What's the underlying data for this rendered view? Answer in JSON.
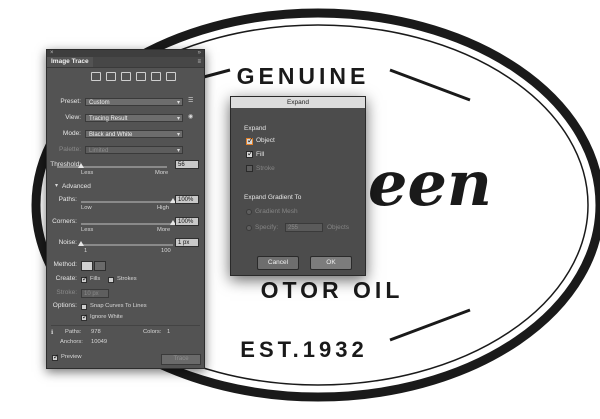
{
  "logo": {
    "top_text": "GENUINE",
    "middle_text": "een",
    "bottom_text": "OTOR OIL",
    "bottom_line": "EST.1932"
  },
  "panel": {
    "close_glyph": "×",
    "collapse_glyph": "»",
    "title": "Image Trace",
    "menu_glyph": "≡",
    "icons": [
      "auto-color-icon",
      "high-color-icon",
      "low-color-icon",
      "grayscale-icon",
      "black-white-icon",
      "outline-icon"
    ],
    "preset_label": "Preset:",
    "preset_value": "Custom",
    "view_label": "View:",
    "view_value": "Tracing Result",
    "mode_label": "Mode:",
    "mode_value": "Black and White",
    "palette_label": "Palette:",
    "palette_value": "Limited",
    "threshold_label": "Threshold:",
    "threshold_value": "56",
    "threshold_min": "Less",
    "threshold_max": "More",
    "advanced_label": "Advanced",
    "paths_label": "Paths:",
    "paths_value": "100%",
    "paths_min": "Low",
    "paths_max": "High",
    "corners_label": "Corners:",
    "corners_value": "100%",
    "corners_min": "Less",
    "corners_max": "More",
    "noise_label": "Noise:",
    "noise_value": "1 px",
    "noise_min": "1",
    "noise_max": "100",
    "method_label": "Method:",
    "create_label": "Create:",
    "fills_label": "Fills",
    "strokes_label": "Strokes",
    "stroke_label": "Stroke:",
    "stroke_value": "10 px",
    "options_label": "Options:",
    "snap_label": "Snap Curves To Lines",
    "ignore_white_label": "Ignore White",
    "paths_count_label": "Paths:",
    "paths_count": "978",
    "colors_label": "Colors:",
    "colors_count": "1",
    "anchors_label": "Anchors:",
    "anchors_count": "10049",
    "preview_label": "Preview",
    "trace_button": "Trace",
    "threshold_level": 0.22,
    "paths_level": 1.0,
    "corners_level": 1.0,
    "noise_level": 0.0
  },
  "dialog": {
    "title": "Expand",
    "expand_heading": "Expand",
    "object_label": "Object",
    "fill_label": "Fill",
    "stroke_label": "Stroke",
    "gradient_heading": "Expand Gradient To",
    "gradient_mesh_label": "Gradient Mesh",
    "specify_label": "Specify:",
    "specify_value": "255",
    "objects_label": "Objects",
    "cancel_button": "Cancel",
    "ok_button": "OK"
  }
}
